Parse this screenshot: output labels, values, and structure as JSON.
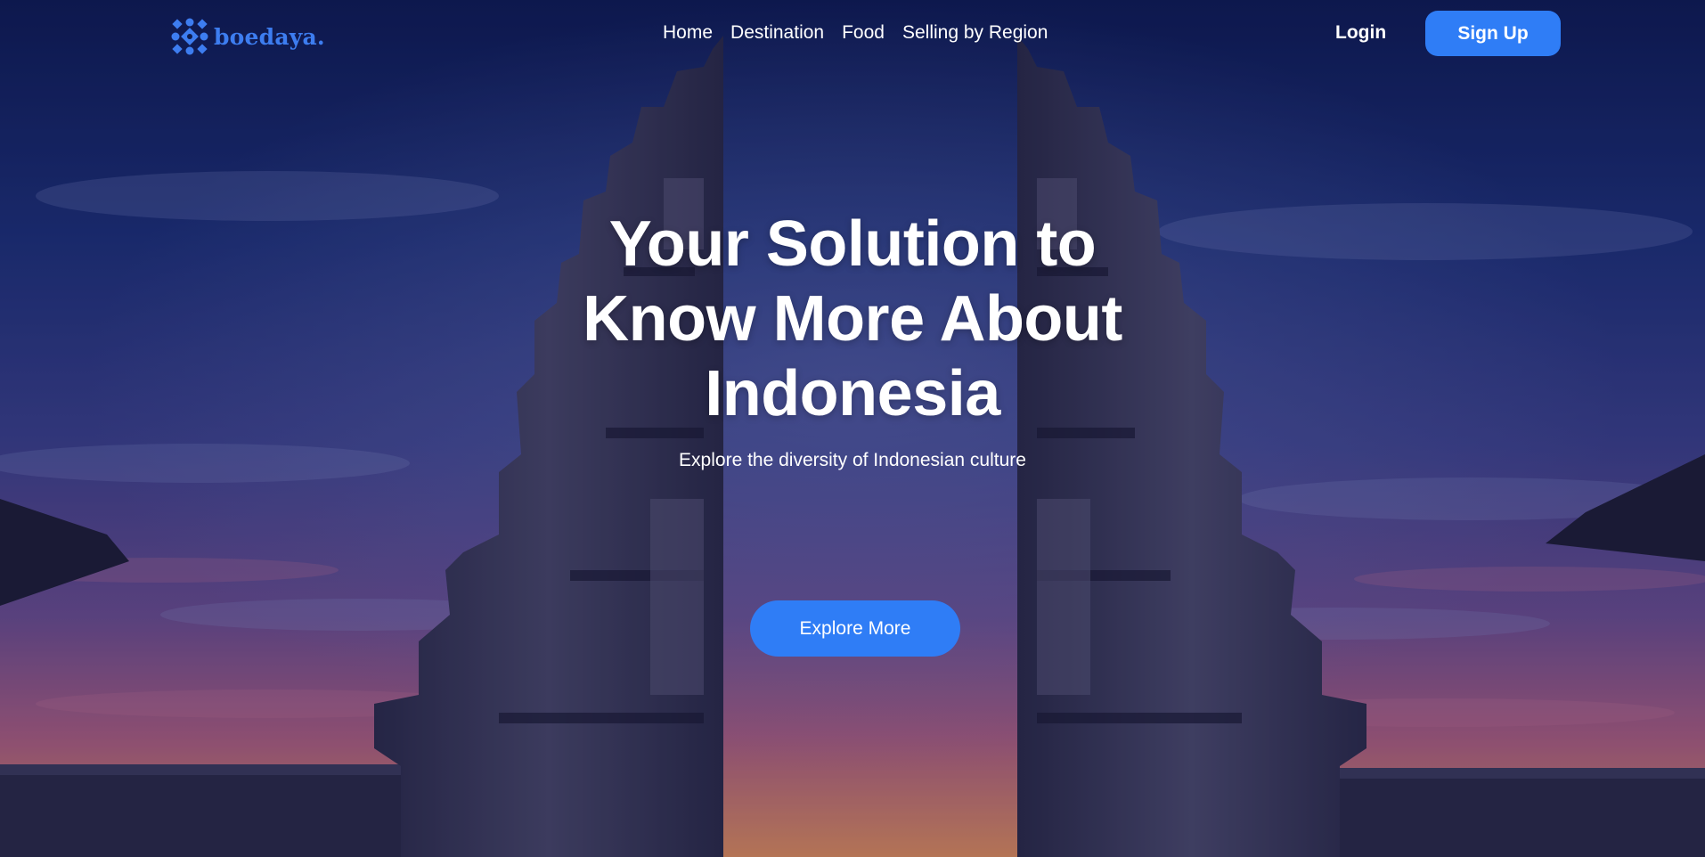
{
  "brand": {
    "name": "boedaya.",
    "icon": "batik-flower-icon",
    "color": "#3d7df0"
  },
  "nav": {
    "links": [
      "Home",
      "Destination",
      "Food",
      "Selling by Region"
    ],
    "login_label": "Login",
    "signup_label": "Sign Up"
  },
  "hero": {
    "title_lines": [
      "Your Solution to",
      "Know More About",
      "Indonesia"
    ],
    "subtitle": "Explore the diversity of Indonesian culture",
    "cta_label": "Explore More",
    "background": "temple-gate-sunset-image"
  },
  "colors": {
    "accent": "#2f7df6",
    "sky_top": "#0f1a4a",
    "sky_mid": "#3d3b7a",
    "sky_sunset": "#c06a7a"
  }
}
